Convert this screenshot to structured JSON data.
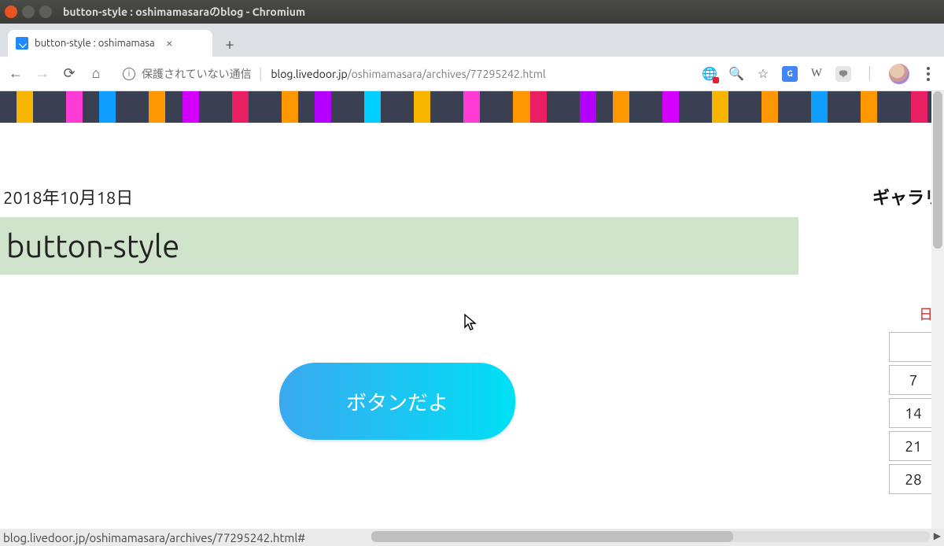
{
  "window": {
    "title": "button-style : oshimamasaraのblog - Chromium"
  },
  "tab": {
    "title": "button-style : oshimamasa",
    "close": "×"
  },
  "toolbar": {
    "secure_label": "保護されていない通信",
    "url_host": "blog.livedoor.jp",
    "url_path": "/oshimamasara/archives/77295242.html"
  },
  "stripe_colors": [
    "#3b3f52",
    "#f7b500",
    "#3b3f52",
    "#3b3f52",
    "#ff3bd6",
    "#3b3f52",
    "#109fff",
    "#3b3f52",
    "#3b3f52",
    "#ff9800",
    "#3b3f52",
    "#d400ff",
    "#3b3f52",
    "#3b3f52",
    "#e91e63",
    "#3b3f52",
    "#3b3f52",
    "#ff9800",
    "#3b3f52",
    "#b400ff",
    "#3b3f52",
    "#3b3f52",
    "#00cfff",
    "#3b3f52",
    "#3b3f52",
    "#f7b500",
    "#3b3f52",
    "#3b3f52",
    "#ff3bd6",
    "#3b3f52",
    "#3b3f52",
    "#ff9800",
    "#e91e63",
    "#3b3f52",
    "#3b3f52",
    "#b400ff",
    "#3b3f52",
    "#ff9800",
    "#3b3f52",
    "#3b3f52",
    "#d400ff",
    "#3b3f52",
    "#3b3f52",
    "#f7b500",
    "#3b3f52",
    "#3b3f52",
    "#ff9800",
    "#3b3f52",
    "#3b3f52",
    "#109fff",
    "#3b3f52",
    "#3b3f52",
    "#ff9800",
    "#3b3f52",
    "#3b3f52",
    "#e91e63",
    "#3b3f52"
  ],
  "page": {
    "date": "2018年10月18日",
    "title": "button-style",
    "button_label": "ボタンだよ"
  },
  "sidebar": {
    "heading": "ギャラリ",
    "cal_head": "日",
    "days": [
      "",
      "7",
      "14",
      "21",
      "28"
    ]
  },
  "status": {
    "text": "blog.livedoor.jp/oshimamasara/archives/77295242.html#"
  }
}
